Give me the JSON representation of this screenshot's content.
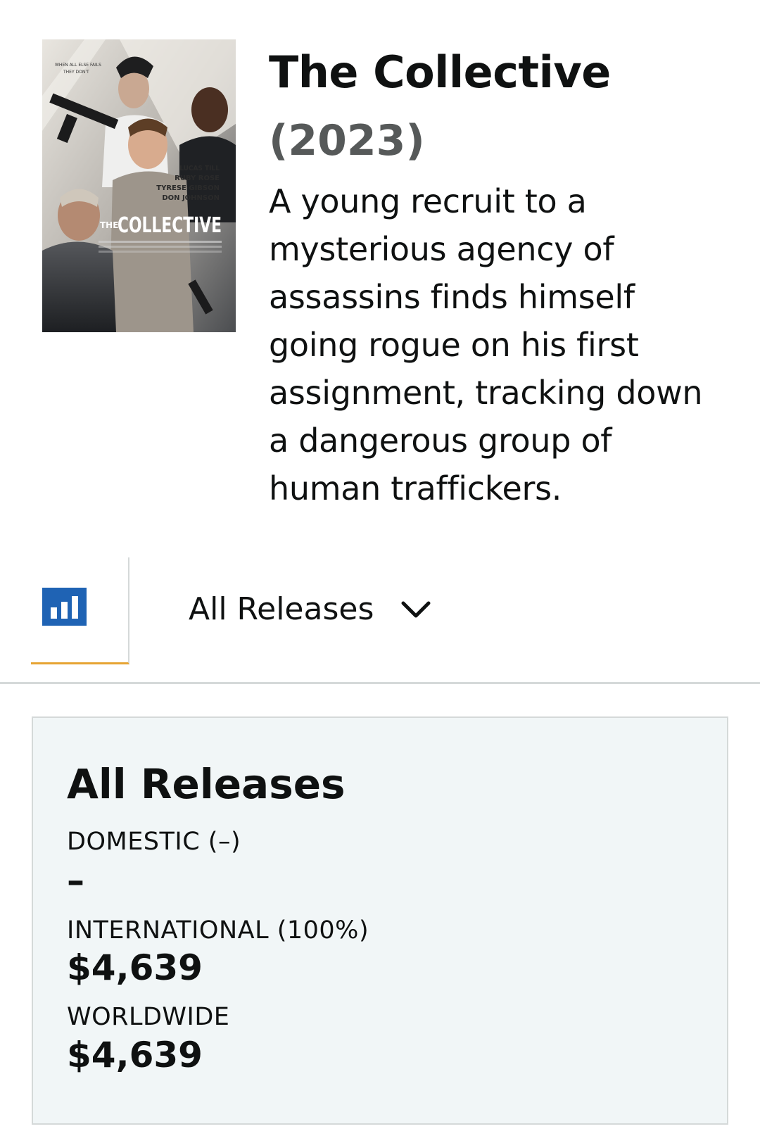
{
  "movie": {
    "title": "The Collective",
    "year": "(2023)",
    "synopsis": "A young recruit to a mysterious agency of assassins finds himself going rogue on his first assignment, tracking down a dangerous group of human traffickers.",
    "poster": {
      "tagline": "WHEN ALL ELSE FAILS THEY DON'T",
      "cast": [
        "LUCAS TILL",
        "RUBY ROSE",
        "TYRESE GIBSON",
        "DON JOHNSON"
      ],
      "title_small": "THE",
      "title_large": "COLLECTIVE"
    }
  },
  "tabs": {
    "chart_icon": "bar-chart-icon",
    "dropdown_label": "All Releases",
    "dropdown_icon": "chevron-down-icon"
  },
  "summary": {
    "title": "All Releases",
    "domestic_label": "DOMESTIC (–)",
    "domestic_value": "–",
    "international_label": "INTERNATIONAL (100%)",
    "international_value": "$4,639",
    "worldwide_label": "WORLDWIDE",
    "worldwide_value": "$4,639"
  },
  "colors": {
    "accent_underline": "#e6a433",
    "chart_icon_bg": "#1f63b4",
    "card_bg": "#f1f6f7",
    "muted_text": "#565959"
  }
}
